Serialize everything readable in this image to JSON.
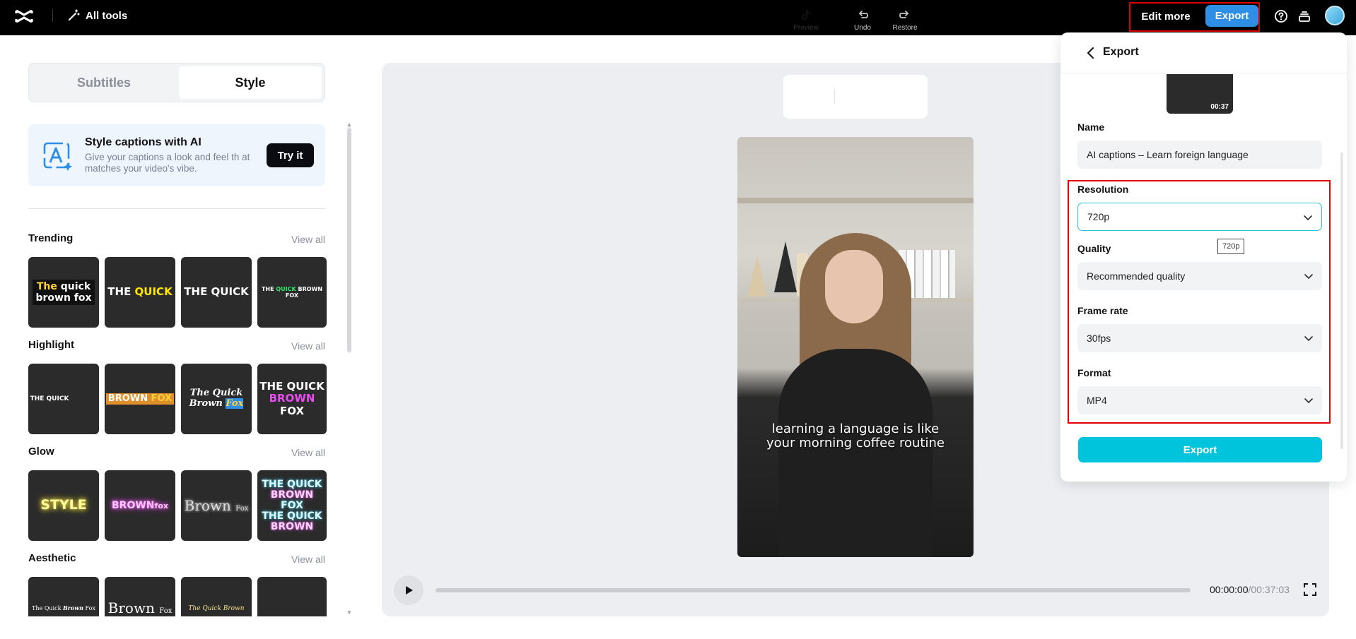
{
  "topbar": {
    "all_tools_label": "All tools",
    "edit_more_label": "Edit more",
    "export_label": "Export"
  },
  "left": {
    "tabs": [
      "Subtitles",
      "Style"
    ],
    "active_tab": "Style",
    "ai_card": {
      "title": "Style captions with AI",
      "description": "Give your captions a look and feel th at matches your video's vibe.",
      "button": "Try it"
    },
    "view_all_label": "View all",
    "sections": [
      {
        "title": "Trending"
      },
      {
        "title": "Highlight"
      },
      {
        "title": "Glow"
      },
      {
        "title": "Aesthetic"
      }
    ],
    "tiles": {
      "trending": [
        "The quick brown fox",
        "THE QUICK",
        "THE QUICK",
        "THE QUICK BROWN FOX"
      ],
      "highlight": [
        "THE QUICK",
        "BROWN FOX",
        "The Quick Brown Fox",
        "THE QUICK BROWN FOX"
      ],
      "glow": [
        "STYLE",
        "BROWN fox",
        "Brown Fox",
        "THE QUICK BROWN FOX THE QUICK BROWN"
      ],
      "aesthetic": [
        "The Quick Brown Fox",
        "Brown Fox",
        "The Quick Brown",
        ""
      ]
    }
  },
  "preview": {
    "toolbar": {
      "preview": "Preview",
      "undo": "Undo",
      "restore": "Restore"
    },
    "subtitle_line1": "learning a language is like",
    "subtitle_line2": "your morning coffee routine",
    "time_current": "00:00:00",
    "time_total": "/00:37:03",
    "progress": 0
  },
  "export_panel": {
    "title": "Export",
    "thumb_duration": "00:37",
    "name_label": "Name",
    "name_value": "AI captions – Learn foreign language",
    "resolution_label": "Resolution",
    "resolution_value": "720p",
    "resolution_tooltip": "720p",
    "quality_label": "Quality",
    "quality_value": "Recommended quality",
    "framerate_label": "Frame rate",
    "framerate_value": "30fps",
    "format_label": "Format",
    "format_value": "MP4",
    "export_button": "Export"
  },
  "colors": {
    "accent_blue": "#2f8fe6",
    "export_cyan": "#00c4dc",
    "highlight_red": "#e00000",
    "active_border": "#2bc6d6"
  }
}
